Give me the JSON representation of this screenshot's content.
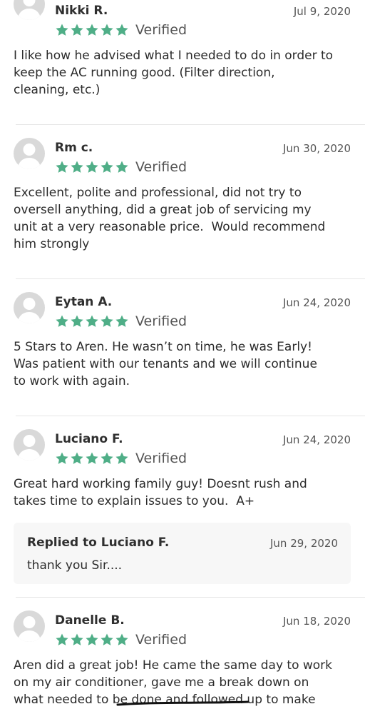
{
  "colors": {
    "star": "#4fae87",
    "avatar_bg": "#d9d9d9",
    "avatar_fg": "#ffffff",
    "reply_bg": "#f7f7f7"
  },
  "reviews": [
    {
      "name": "Nikki R.",
      "date": "Jul 9, 2020",
      "rating": 5,
      "verified": "Verified",
      "text": "I like how he advised what I needed to do in order to\nkeep the AC running good. (Filter direction,\ncleaning, etc.)"
    },
    {
      "name": "Rm c.",
      "date": "Jun 30, 2020",
      "rating": 5,
      "verified": "Verified",
      "text": "Excellent, polite and professional, did not try to\noversell anything, did a great job of servicing my\nunit at a very reasonable price.  Would recommend\nhim strongly"
    },
    {
      "name": "Eytan A.",
      "date": "Jun 24, 2020",
      "rating": 5,
      "verified": "Verified",
      "text": "5 Stars to Aren. He wasn’t on time, he was Early!\nWas patient with our tenants and we will continue\nto work with again."
    },
    {
      "name": "Luciano F.",
      "date": "Jun 24, 2020",
      "rating": 5,
      "verified": "Verified",
      "text": "Great hard working family guy! Doesnt rush and\ntakes time to explain issues to you.  A+",
      "reply": {
        "title": "Replied to Luciano F.",
        "date": "Jun 29, 2020",
        "text": "thank you Sir...."
      }
    },
    {
      "name": "Danelle B.",
      "date": "Jun 18, 2020",
      "rating": 5,
      "verified": "Verified",
      "text": "Aren did a great job! He came the same day to work\non my air conditioner, gave me a break down on\nwhat needed to be done and followed up to make"
    }
  ]
}
